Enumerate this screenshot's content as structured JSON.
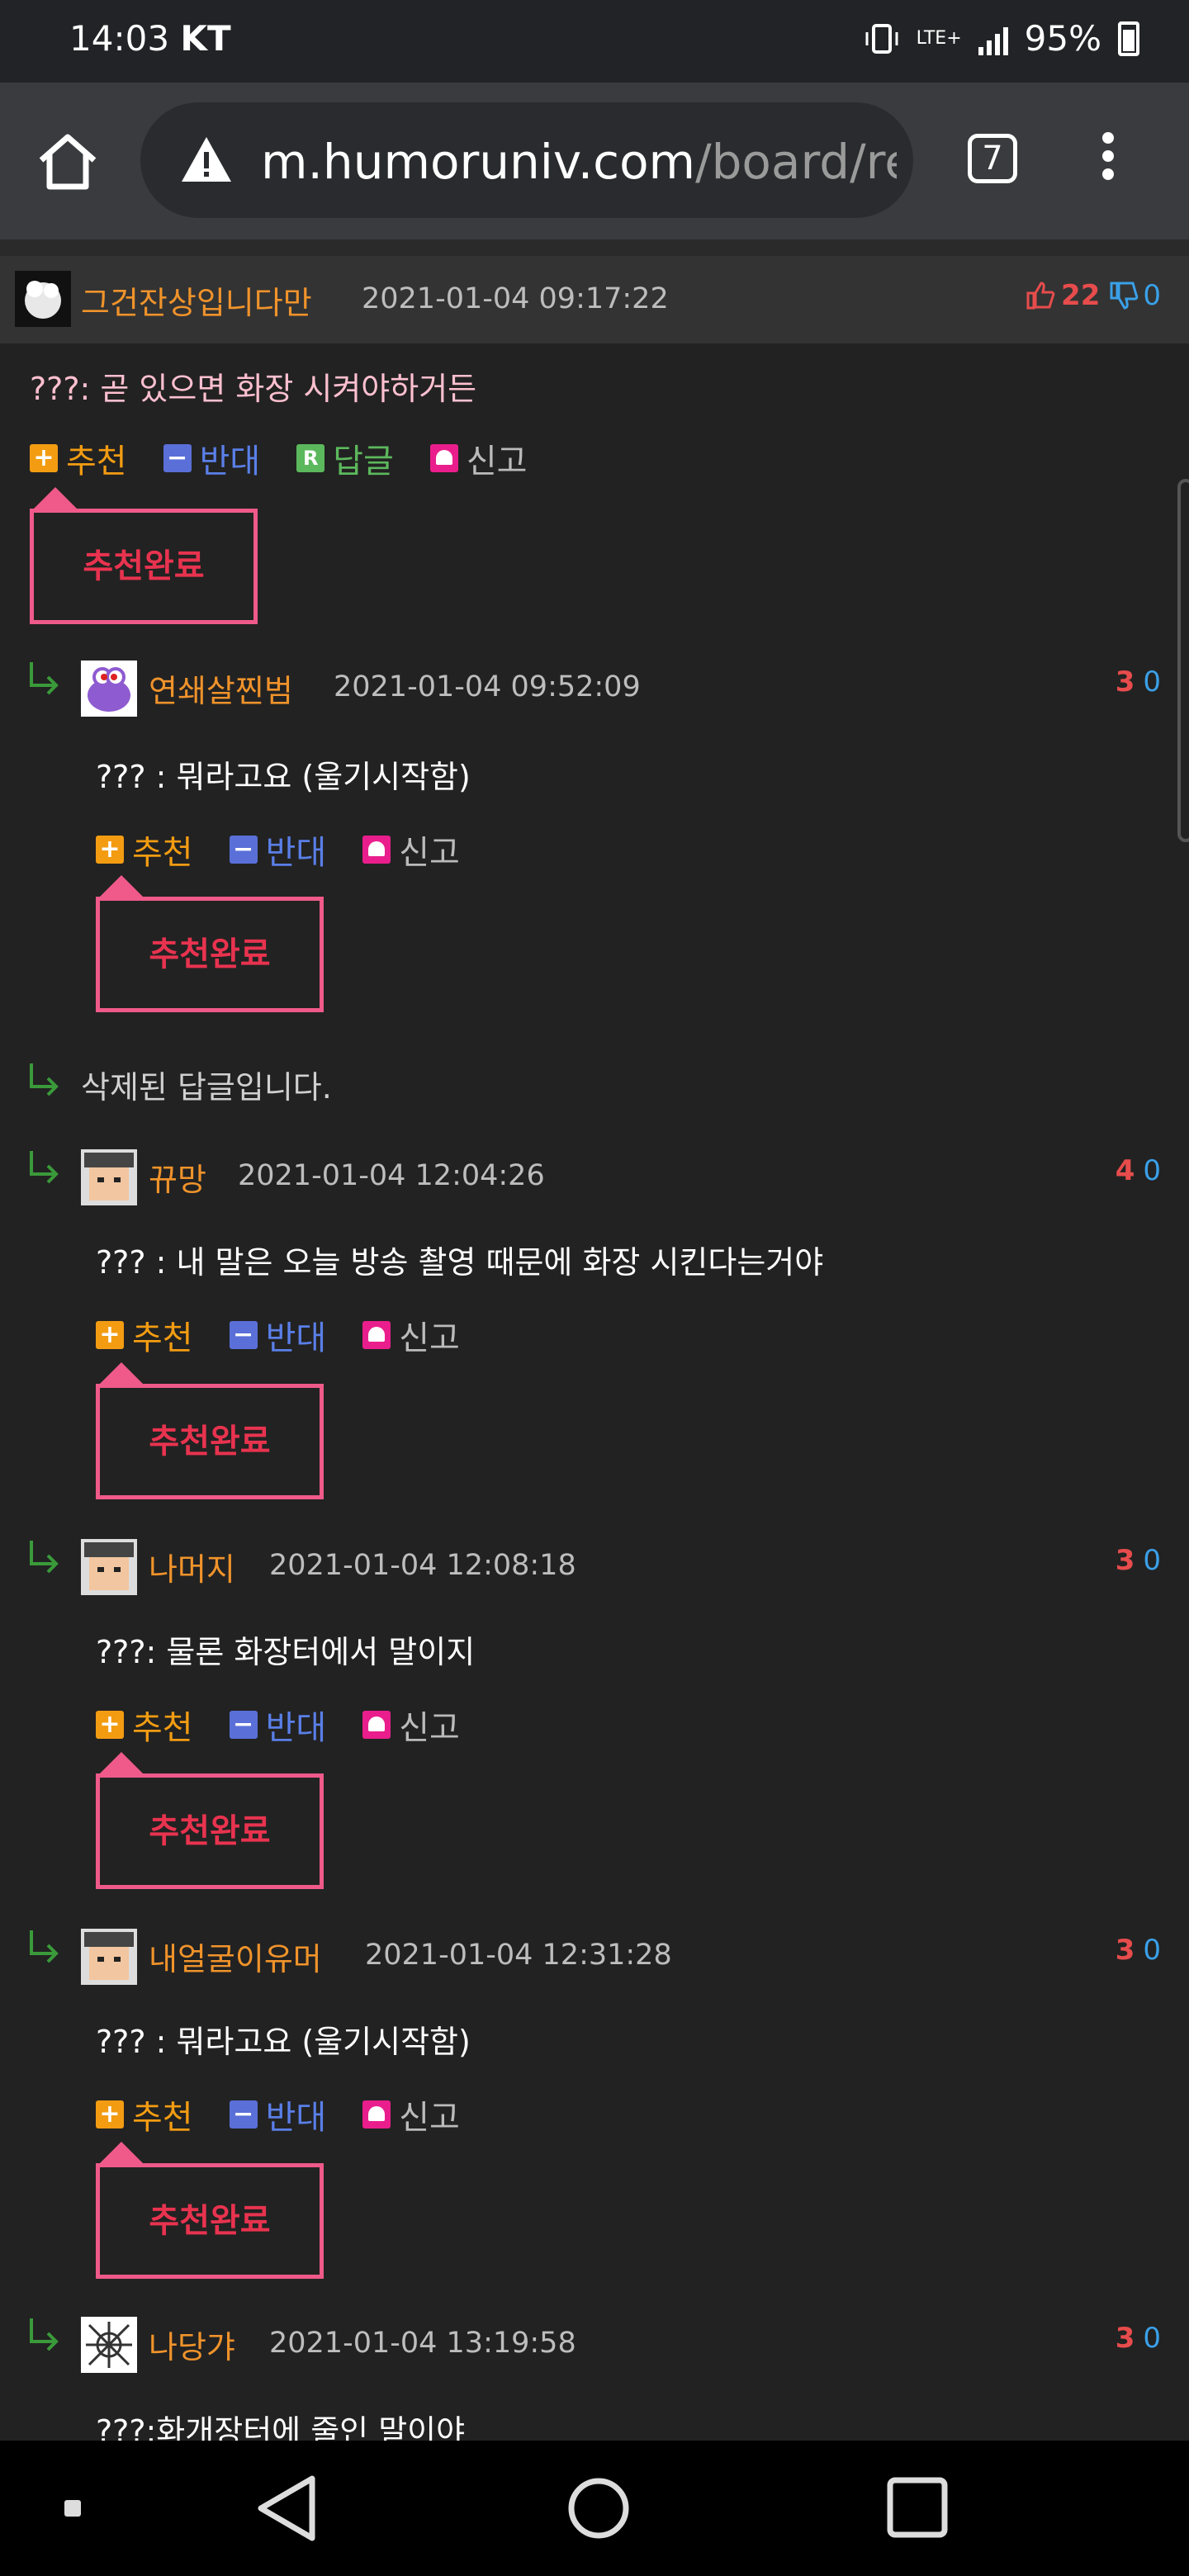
{
  "status_bar": {
    "time": "14:03",
    "carrier": "KT",
    "network": "LTE+",
    "battery": "95%"
  },
  "browser": {
    "url_host": "m.humoruniv.com",
    "url_path": "/board/re",
    "tab_count": "7"
  },
  "top_comment": {
    "author": "그건잔상입니다만",
    "date": "2021-01-04 09:17:22",
    "upvotes": "22",
    "downvotes": "0",
    "text": "???: 곧 있으면 화장 시켜야하거든",
    "actions": {
      "recommend": "추천",
      "oppose": "반대",
      "reply": "답글",
      "report": "신고"
    },
    "recommended_label": "추천완료"
  },
  "replies": [
    {
      "author": "연쇄살찐범",
      "date": "2021-01-04 09:52:09",
      "upvotes": "3",
      "downvotes": "0",
      "text": "??? : 뭐라고요 (울기시작함)",
      "recommend": "추천",
      "oppose": "반대",
      "report": "신고",
      "recommended_label": "추천완료"
    },
    {
      "deleted_text": "삭제된 답글입니다."
    },
    {
      "author": "뀨망",
      "date": "2021-01-04 12:04:26",
      "upvotes": "4",
      "downvotes": "0",
      "text": "??? : 내 말은 오늘 방송 촬영 때문에 화장 시킨다는거야",
      "recommend": "추천",
      "oppose": "반대",
      "report": "신고",
      "recommended_label": "추천완료"
    },
    {
      "author": "나머지",
      "date": "2021-01-04 12:08:18",
      "upvotes": "3",
      "downvotes": "0",
      "text": "???: 물론 화장터에서 말이지",
      "recommend": "추천",
      "oppose": "반대",
      "report": "신고",
      "recommended_label": "추천완료"
    },
    {
      "author": "내얼굴이유머",
      "date": "2021-01-04 12:31:28",
      "upvotes": "3",
      "downvotes": "0",
      "text": "??? : 뭐라고요 (울기시작함)",
      "recommend": "추천",
      "oppose": "반대",
      "report": "신고",
      "recommended_label": "추천완료"
    },
    {
      "author": "나당갸",
      "date": "2021-01-04 13:19:58",
      "upvotes": "3",
      "downvotes": "0",
      "text": "???:화개장터에 줄인 말이야"
    }
  ],
  "icons": {
    "home": "home-icon",
    "warning": "warning-icon",
    "menu": "more-vert-icon",
    "thumb_up": "thumb-up-icon",
    "thumb_down": "thumb-down-icon",
    "reply_arrow": "reply-arrow-icon",
    "nav_back": "back-triangle-icon",
    "nav_home": "home-circle-icon",
    "nav_recent": "recent-square-icon"
  },
  "colors": {
    "author": "#f0932b",
    "upvote": "#e74c4c",
    "downvote": "#3aa0e8",
    "recommended_border": "#ef5a8a",
    "recommended_text": "#e8334f"
  }
}
